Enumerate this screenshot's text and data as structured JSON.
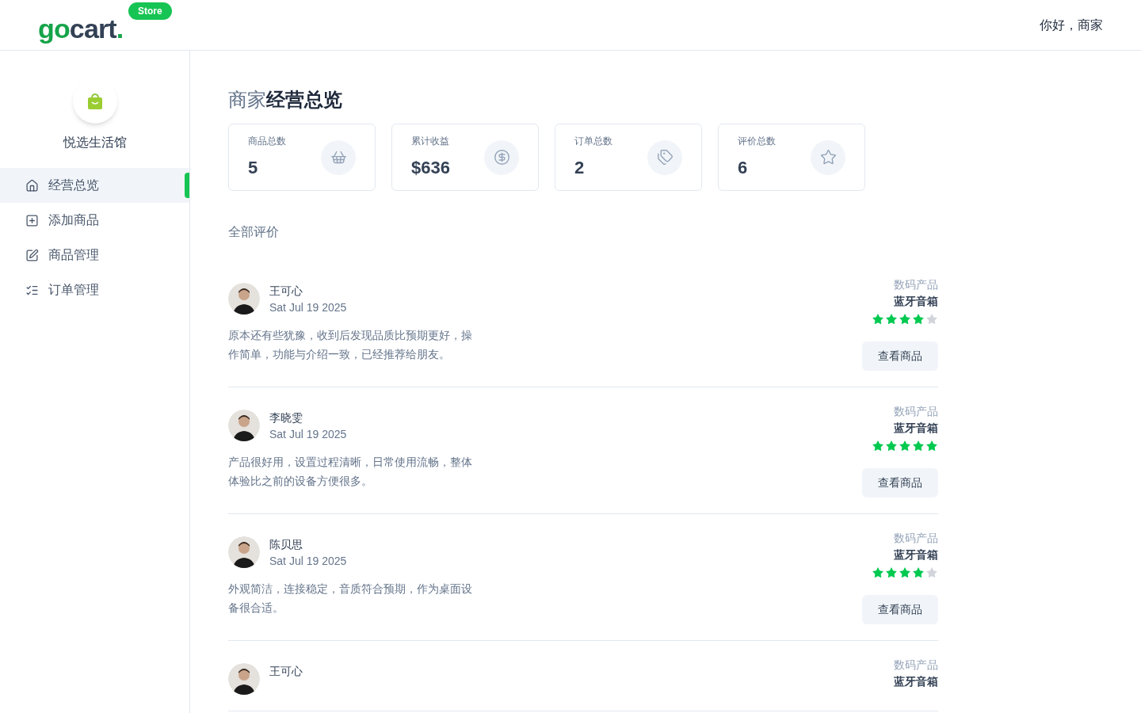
{
  "header": {
    "logo_prefix": "go",
    "logo_main": "cart",
    "logo_dot": ".",
    "badge": "Store",
    "greeting": "你好，商家"
  },
  "sidebar": {
    "store_name": "悦选生活馆",
    "items": [
      {
        "label": "经营总览",
        "selected": true
      },
      {
        "label": "添加商品",
        "selected": false
      },
      {
        "label": "商品管理",
        "selected": false
      },
      {
        "label": "订单管理",
        "selected": false
      }
    ]
  },
  "title": {
    "light": "商家",
    "bold": "经营总览"
  },
  "stats": [
    {
      "label": "商品总数",
      "value": "5"
    },
    {
      "label": "累计收益",
      "value": "$636"
    },
    {
      "label": "订单总数",
      "value": "2"
    },
    {
      "label": "评价总数",
      "value": "6"
    }
  ],
  "reviews_heading": "全部评价",
  "reviews": [
    {
      "name": "王可心",
      "date": "Sat Jul 19 2025",
      "text": "原本还有些犹豫，收到后发现品质比预期更好，操作简单，功能与介绍一致，已经推荐给朋友。",
      "category": "数码产品",
      "product": "蓝牙音箱",
      "stars": 4,
      "button": "查看商品"
    },
    {
      "name": "李晓雯",
      "date": "Sat Jul 19 2025",
      "text": "产品很好用，设置过程清晰，日常使用流畅，整体体验比之前的设备方便很多。",
      "category": "数码产品",
      "product": "蓝牙音箱",
      "stars": 5,
      "button": "查看商品"
    },
    {
      "name": "陈贝思",
      "date": "Sat Jul 19 2025",
      "text": "外观简洁，连接稳定，音质符合预期，作为桌面设备很合适。",
      "category": "数码产品",
      "product": "蓝牙音箱",
      "stars": 4,
      "button": "查看商品"
    },
    {
      "name": "王可心",
      "category": "数码产品",
      "product": "蓝牙音箱"
    }
  ]
}
